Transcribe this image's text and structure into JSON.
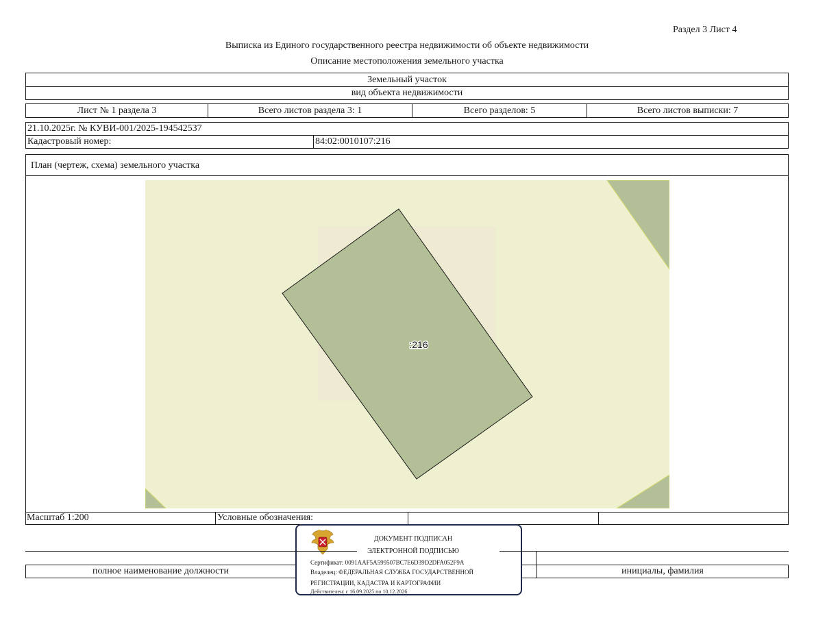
{
  "header": {
    "section_sheet": "Раздел 3   Лист 4",
    "title": "Выписка из Единого государственного реестра недвижимости об объекте недвижимости",
    "subtitle": "Описание местоположения земельного участка"
  },
  "object": {
    "type": "Земельный участок",
    "type_caption": "вид объекта недвижимости"
  },
  "sheets": {
    "sheet_of_section": "Лист № 1 раздела 3",
    "total_sheets_section": "Всего листов раздела 3: 1",
    "total_sections": "Всего разделов: 5",
    "total_sheets_extract": "Всего листов выписки: 7"
  },
  "record": {
    "date_number": "21.10.2025г. № КУВИ-001/2025-194542537",
    "cadastral_label": "Кадастровый номер:",
    "cadastral_number": "84:02:0010107:216"
  },
  "plan": {
    "caption": "План (чертеж, схема) земельного участка",
    "parcel_label": ":216",
    "colors": {
      "background": "#eff0cf",
      "parcel_fill": "#b3bf96",
      "parcel_stroke": "#1a1a1a",
      "neighbor_fill": "#b3bf96"
    }
  },
  "legend_row": {
    "scale": "Масштаб 1:200",
    "legend_label": "Условные обозначения:"
  },
  "signature_row": {
    "position_caption": "полное наименование должности",
    "name_caption": "инициалы, фамилия"
  },
  "stamp": {
    "line1": "ДОКУМЕНТ ПОДПИСАН",
    "line2": "ЭЛЕКТРОННОЙ ПОДПИСЬЮ",
    "certificate": "Сертификат: 0091AAF5A599507BC7E6D39D2DFA052F9A",
    "owner_line1": "Владелец: ФЕДЕРАЛЬНАЯ СЛУЖБА ГОСУДАРСТВЕННОЙ",
    "owner_line2": "РЕГИСТРАЦИИ, КАДАСТРА И КАРТОГРАФИИ",
    "validity": "Действителен: с 16.09.2025 по 10.12.2026",
    "emblem_icon": "coat-of-arms-icon",
    "border_color": "#1f2a4d"
  }
}
